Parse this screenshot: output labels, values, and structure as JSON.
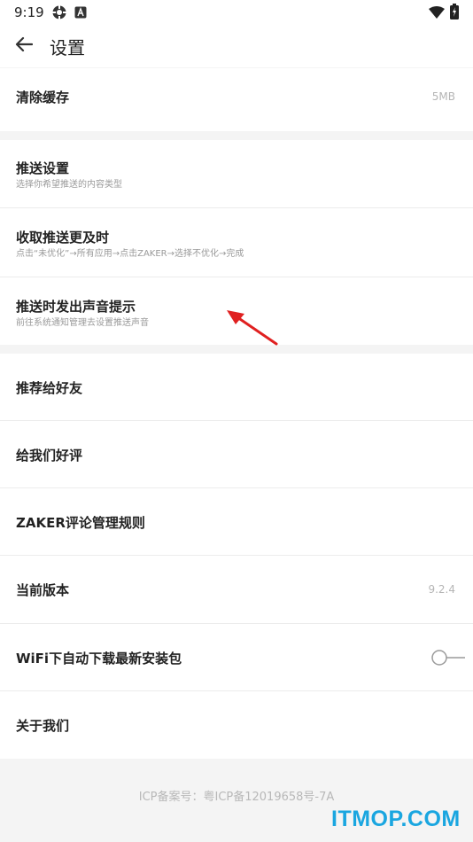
{
  "status_bar": {
    "time": "9:19",
    "icons": [
      "settings-app-icon",
      "android-a-icon",
      "wifi-icon",
      "battery-charging-icon"
    ]
  },
  "header": {
    "title": "设置",
    "back_icon": "arrow-left-icon"
  },
  "sections": {
    "cache": {
      "title": "清除缓存",
      "value": "5MB"
    },
    "push": {
      "settings_title": "推送设置",
      "settings_sub": "选择你希望推送的内容类型",
      "timely_title": "收取推送更及时",
      "timely_sub": "点击“未优化”→所有应用→点击ZAKER→选择不优化→完成",
      "sound_title": "推送时发出声音提示",
      "sound_sub": "前往系统通知管理去设置推送声音"
    },
    "general": {
      "recommend": "推荐给好友",
      "rate": "给我们好评",
      "rules": "ZAKER评论管理规则",
      "version_title": "当前版本",
      "version_value": "9.2.4",
      "wifi_title": "WiFi下自动下载最新安装包",
      "wifi_toggle_on": false,
      "about": "关于我们"
    }
  },
  "footer": {
    "icp": "ICP备案号：粤ICP备12019658号-7A"
  },
  "watermark": "ITMOP.COM",
  "colors": {
    "accent_arrow": "#e02020",
    "watermark": "#1aa6e0",
    "background": "#f4f4f4"
  }
}
